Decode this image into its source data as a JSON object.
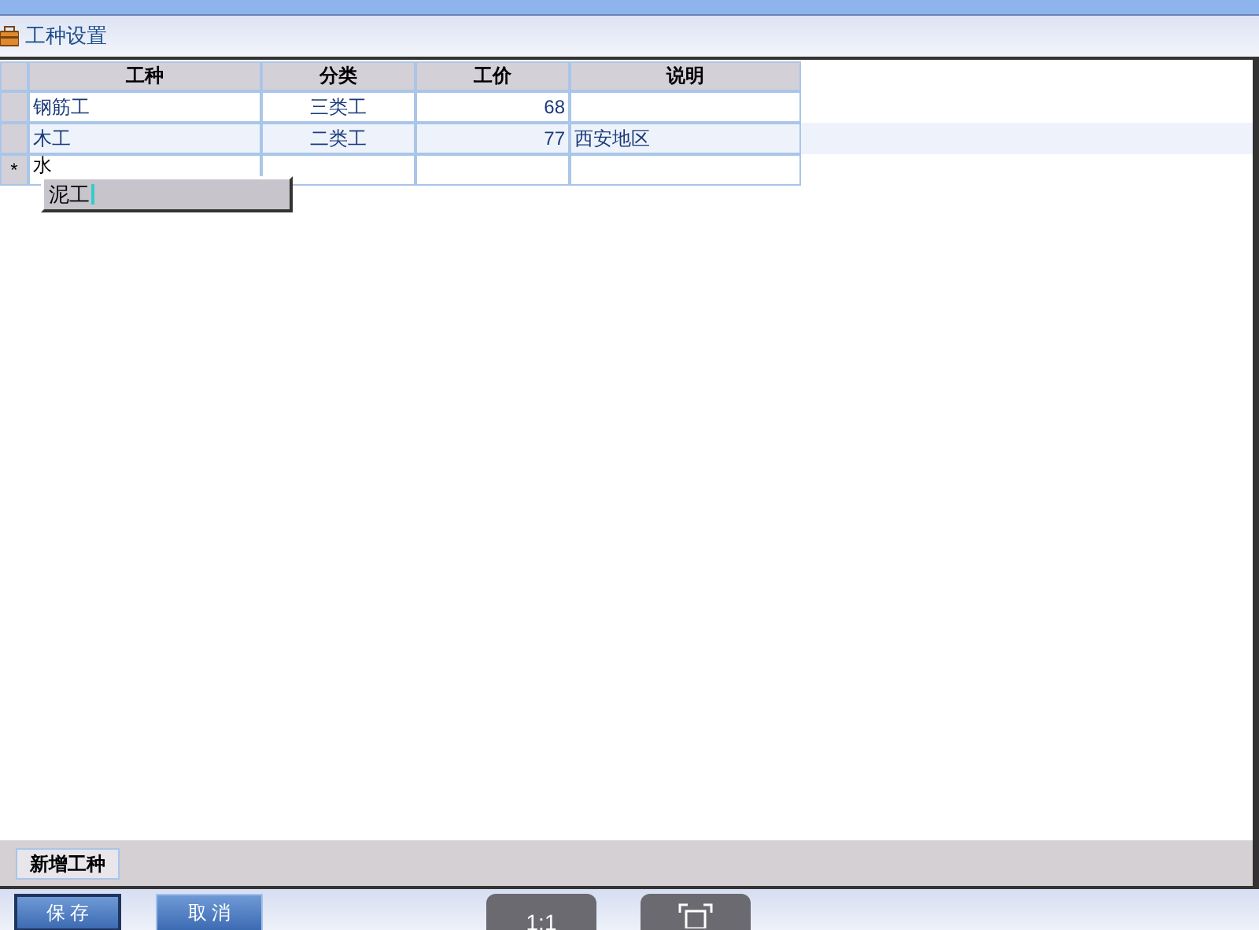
{
  "header": {
    "title": "工种设置"
  },
  "table": {
    "columns": [
      "工种",
      "分类",
      "工价",
      "说明"
    ],
    "rows": [
      {
        "kind": "data",
        "cells": [
          "钢筋工",
          "三类工",
          "68",
          ""
        ]
      },
      {
        "kind": "data",
        "cells": [
          "木工",
          "二类工",
          "77",
          "西安地区"
        ]
      },
      {
        "kind": "new",
        "marker": "*",
        "cells": [
          "水",
          "",
          "",
          ""
        ]
      }
    ]
  },
  "autocomplete": {
    "value": "泥工"
  },
  "action_bar": {
    "button": "新增工种"
  },
  "footer": {
    "buttons": [
      {
        "kind": "primary",
        "label": "保 存",
        "selected": true
      },
      {
        "kind": "primary",
        "label": "取 消",
        "selected": false
      },
      {
        "kind": "view",
        "label": "1:1"
      },
      {
        "kind": "fit"
      }
    ]
  }
}
